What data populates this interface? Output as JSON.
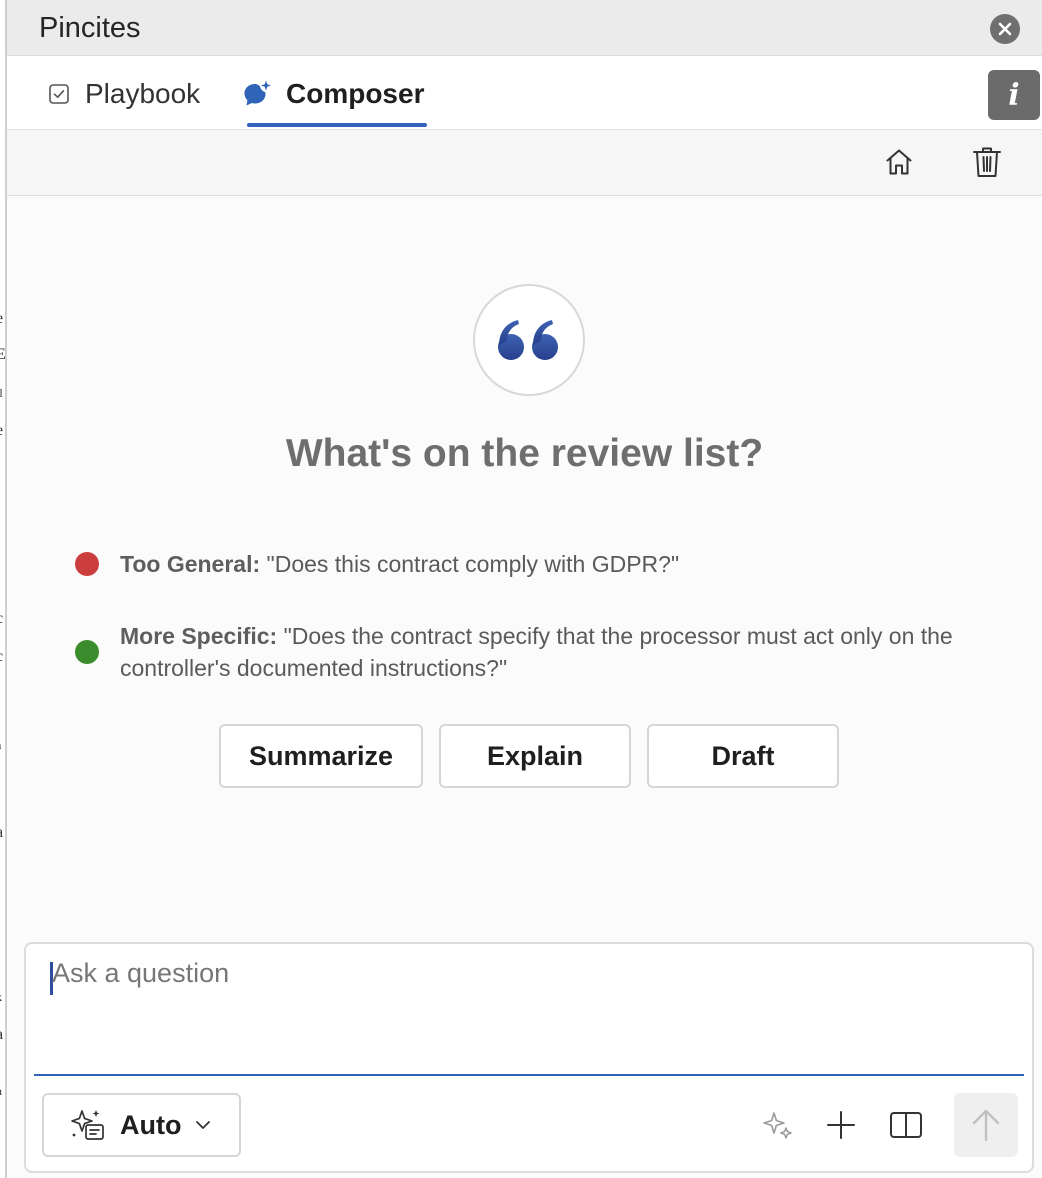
{
  "app": {
    "title": "Pincites"
  },
  "tabs": [
    {
      "label": "Playbook",
      "icon": "checkbox-icon",
      "active": false
    },
    {
      "label": "Composer",
      "icon": "sparkle-chat-icon",
      "active": true
    }
  ],
  "toolbar": {
    "home_icon": "home-icon",
    "delete_icon": "trash-icon"
  },
  "main": {
    "heading": "What's on the review list?",
    "examples": [
      {
        "label": "Too General:",
        "text": " \"Does this contract comply with GDPR?\"",
        "status_color": "#cc3d3d"
      },
      {
        "label": "More Specific:",
        "text": " \"Does the contract specify that the processor must act only on the controller's documented instructions?\"",
        "status_color": "#3a8c2c"
      }
    ],
    "actions": [
      {
        "label": "Summarize"
      },
      {
        "label": "Explain"
      },
      {
        "label": "Draft"
      }
    ]
  },
  "composer": {
    "placeholder": "Ask a question",
    "value": "",
    "mode_label": "Auto"
  },
  "doc_fragments": [
    "e",
    "E",
    "il",
    "e",
    "c",
    "c",
    "a",
    "a",
    "l",
    "t",
    "k",
    "a",
    "n"
  ],
  "colors": {
    "accent": "#2f64b8",
    "quote": "#2f4d9e"
  }
}
